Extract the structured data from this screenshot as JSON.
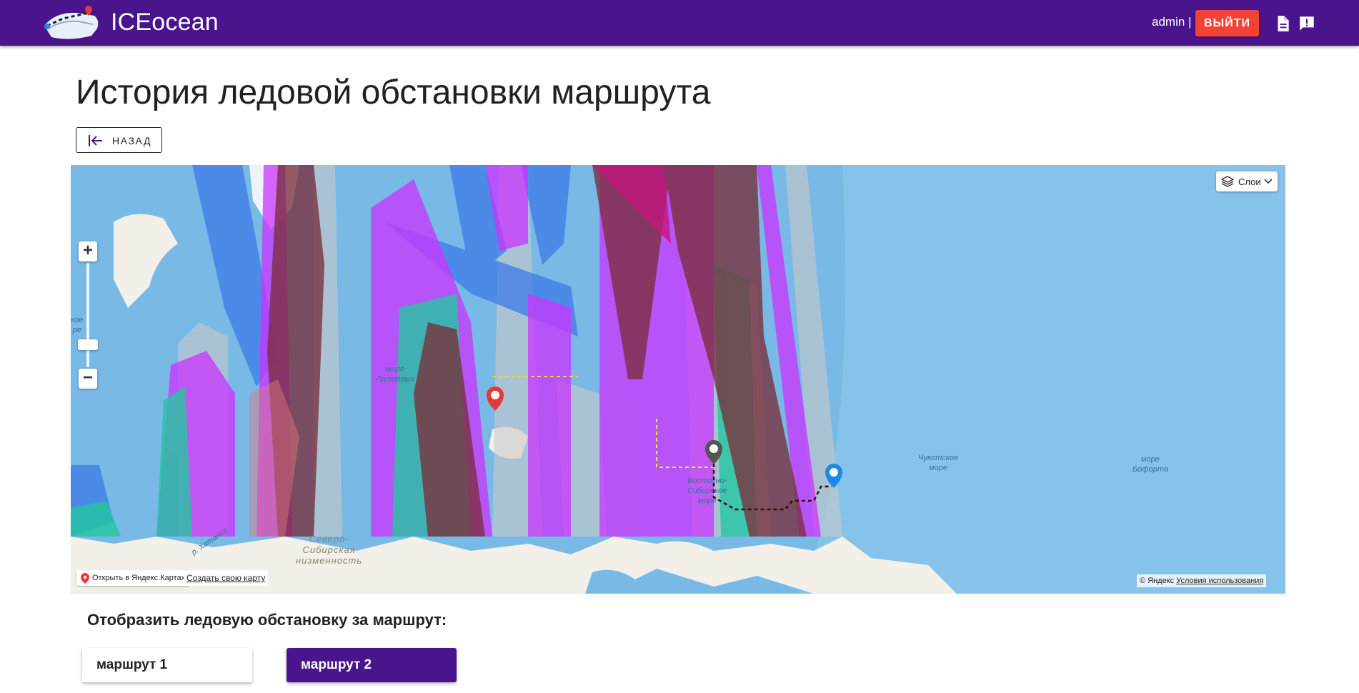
{
  "header": {
    "brand": "ICEocean",
    "user": "admin |",
    "logout_label": "выйти",
    "icons": [
      "document-icon",
      "feedback-icon"
    ],
    "colors": {
      "bar": "#4a148c",
      "logout": "#f44336"
    }
  },
  "page": {
    "title": "История ледовой обстановки маршрута",
    "back_label": "назад"
  },
  "map": {
    "layers_label": "Слои",
    "labels": {
      "laptev": "море\nЛаптевых",
      "east_siberian": "Восточно-\nСибирское\nморе",
      "chukchi": "Чукотское\nморе",
      "beaufort": "море\nБофорта",
      "kara_fragment": "кое\nре",
      "lowland": "Северо-\nСибирская\nнизменность",
      "khatanga": "р. Хатанга"
    },
    "open_in_yandex": "Открыть в Яндекс.Картах",
    "create_map": "Создать свою карту",
    "copyright": "© Яндекс",
    "terms": "Условия использования",
    "markers": [
      "red-pin",
      "gray-pin",
      "blue-pin"
    ]
  },
  "routes": {
    "prompt": "Отобразить ледовую обстановку за маршрут:",
    "items": [
      {
        "label": "маршрут 1",
        "selected": false
      },
      {
        "label": "маршрут 2",
        "selected": true
      }
    ]
  }
}
